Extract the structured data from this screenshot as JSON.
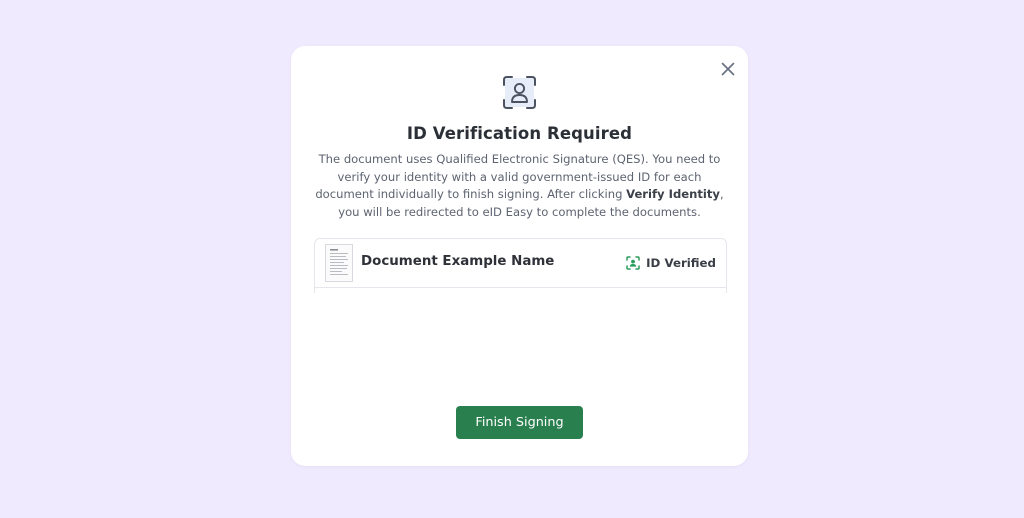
{
  "modal": {
    "title": "ID Verification Required",
    "description": {
      "part1": "The document uses Qualified Electronic Signature (QES). You need to verify your identity with a valid government-issued ID for each document individually to finish signing. After clicking ",
      "emphasis": "Verify Identity",
      "part2": ", you will be redirected to eID Easy to complete the documents."
    },
    "icons": {
      "close": "close-icon",
      "hero": "id-scan-icon",
      "document": "document-thumbnail",
      "verified": "id-verified-icon"
    },
    "documents": [
      {
        "name": "Document Example Name",
        "status": "ID Verified"
      }
    ],
    "finish_button_label": "Finish Signing"
  },
  "colors": {
    "background": "#efeafd",
    "primary": "#2a7f4f",
    "verified": "#2a9d5c"
  }
}
